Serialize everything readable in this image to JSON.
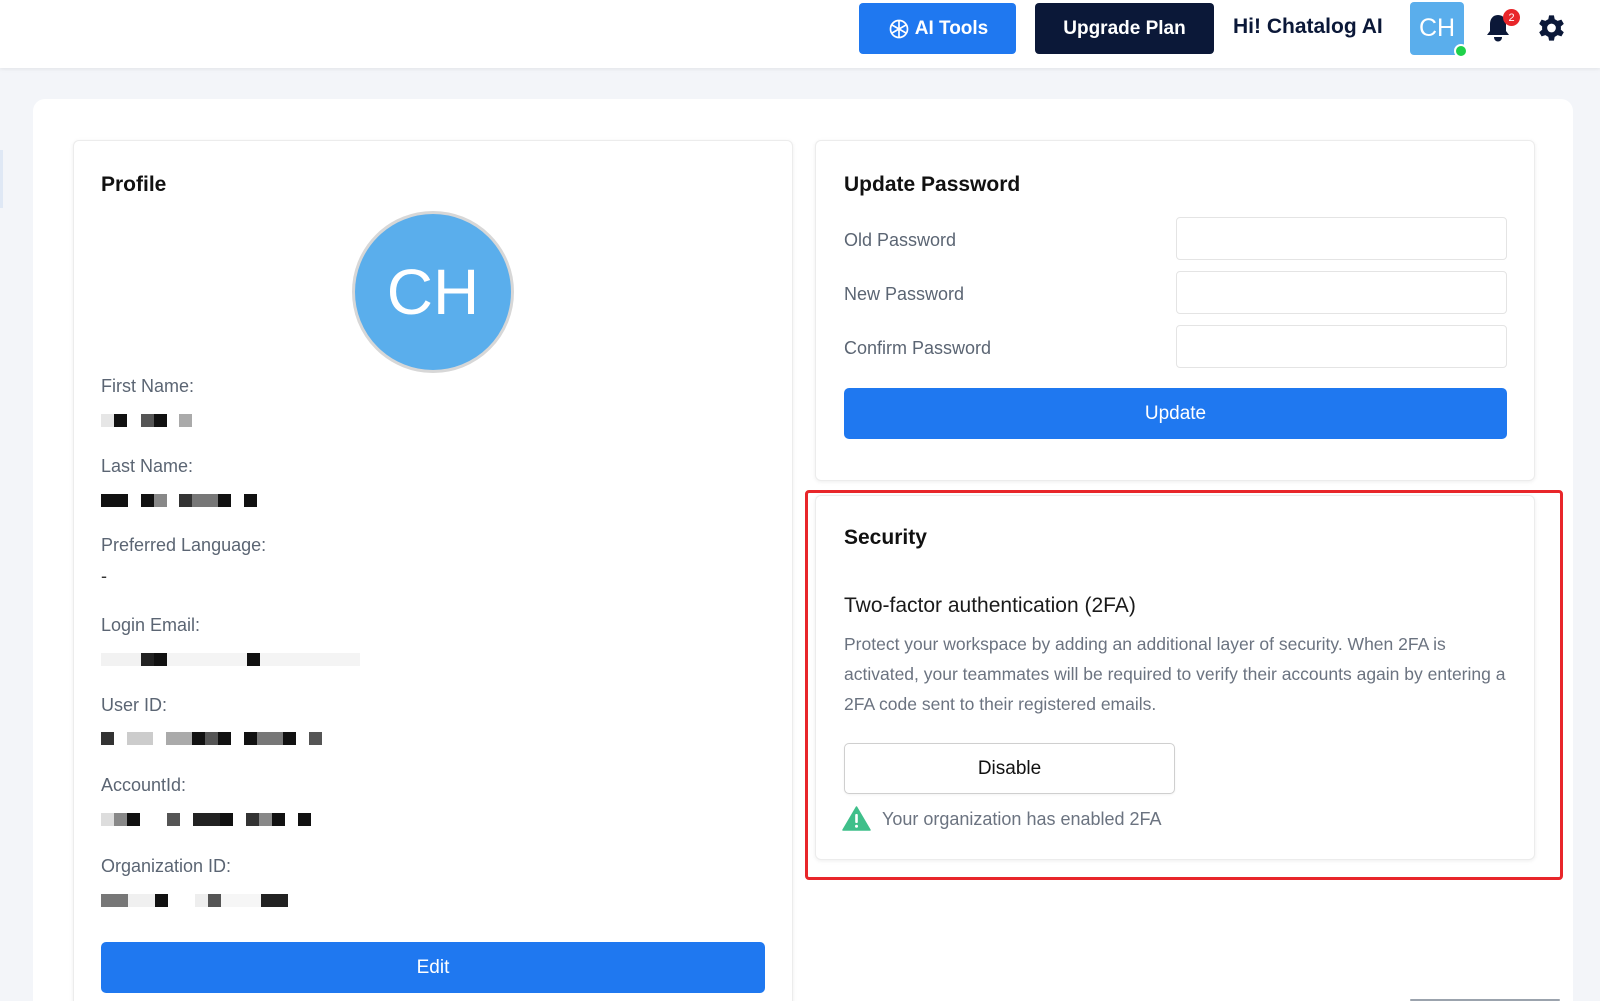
{
  "topbar": {
    "ai_tools_label": "AI Tools",
    "upgrade_label": "Upgrade Plan",
    "greeting": "Hi! Chatalog AI",
    "avatar_initials": "CH",
    "notification_count": "2"
  },
  "profile": {
    "title": "Profile",
    "avatar_initials": "CH",
    "fields": [
      {
        "label": "First Name:",
        "value": ""
      },
      {
        "label": "Last Name:",
        "value": ""
      },
      {
        "label": "Preferred Language:",
        "value": "-"
      },
      {
        "label": "Login Email:",
        "value": ""
      },
      {
        "label": "User ID:",
        "value": ""
      },
      {
        "label": "AccountId:",
        "value": ""
      },
      {
        "label": "Organization ID:",
        "value": ""
      }
    ],
    "edit_label": "Edit"
  },
  "password": {
    "title": "Update Password",
    "old_label": "Old Password",
    "new_label": "New Password",
    "confirm_label": "Confirm Password",
    "update_label": "Update"
  },
  "security": {
    "title": "Security",
    "twofa_title": "Two-factor authentication (2FA)",
    "twofa_description": "Protect your workspace by adding an additional layer of security. When 2FA is activated, your teammates will be required to verify their accounts again by entering a 2FA code sent to their registered emails.",
    "disable_label": "Disable",
    "status_note": "Your organization has enabled 2FA"
  },
  "colors": {
    "primary": "#1f78f0",
    "navy": "#0b1838",
    "avatar": "#5aaeec",
    "online": "#1fd14a",
    "badge": "#e8262a",
    "warning_icon": "#3fbf8a",
    "highlight": "#e8262a"
  }
}
